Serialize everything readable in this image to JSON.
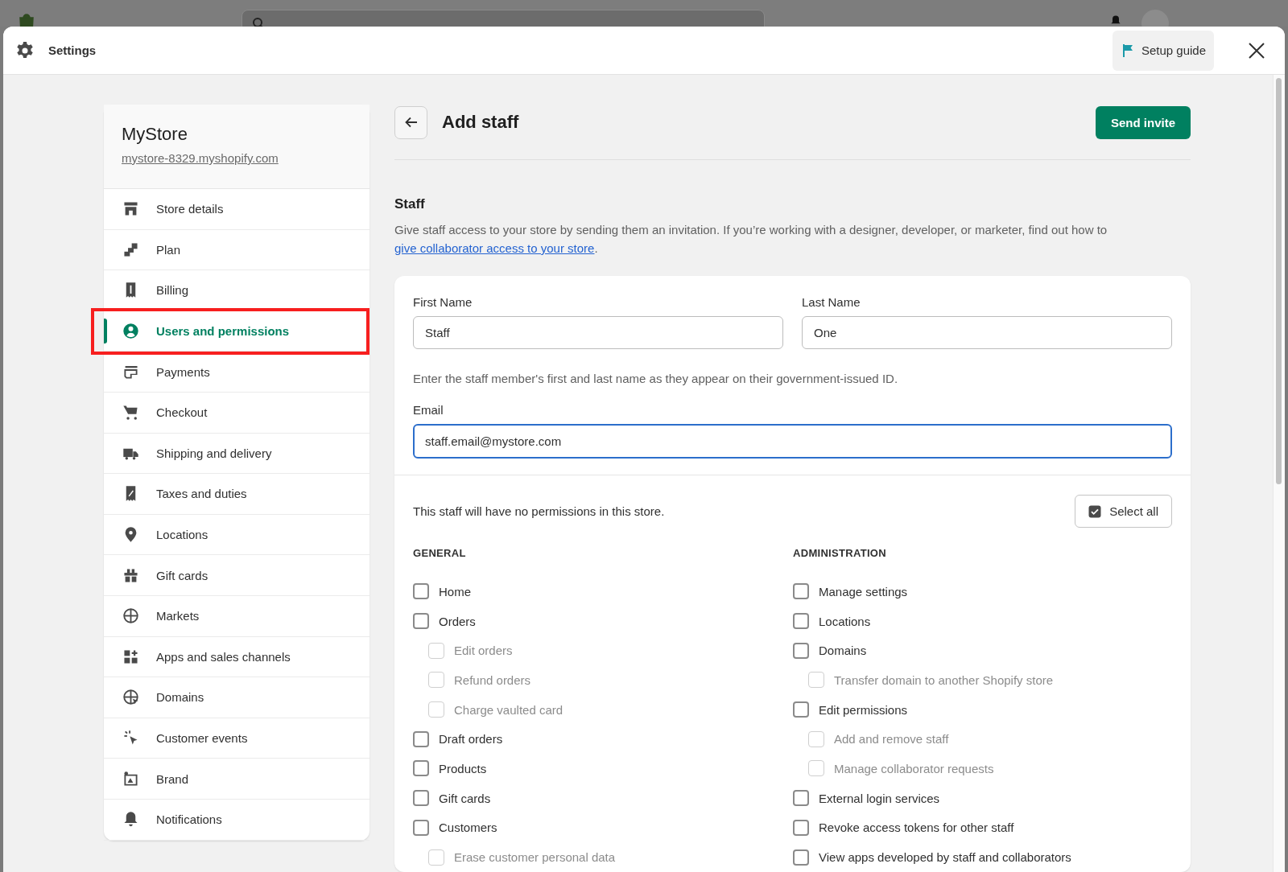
{
  "modal": {
    "title": "Settings",
    "setup_guide": "Setup guide"
  },
  "sidebar": {
    "store_name": "MyStore",
    "store_url": "mystore-8329.myshopify.com",
    "items": [
      {
        "label": "Store details",
        "selected": false,
        "outlined": false
      },
      {
        "label": "Plan",
        "selected": false,
        "outlined": false
      },
      {
        "label": "Billing",
        "selected": false,
        "outlined": false
      },
      {
        "label": "Users and permissions",
        "selected": true,
        "outlined": true
      },
      {
        "label": "Payments",
        "selected": false,
        "outlined": false
      },
      {
        "label": "Checkout",
        "selected": false,
        "outlined": false
      },
      {
        "label": "Shipping and delivery",
        "selected": false,
        "outlined": false
      },
      {
        "label": "Taxes and duties",
        "selected": false,
        "outlined": false
      },
      {
        "label": "Locations",
        "selected": false,
        "outlined": false
      },
      {
        "label": "Gift cards",
        "selected": false,
        "outlined": false
      },
      {
        "label": "Markets",
        "selected": false,
        "outlined": false
      },
      {
        "label": "Apps and sales channels",
        "selected": false,
        "outlined": false
      },
      {
        "label": "Domains",
        "selected": false,
        "outlined": false
      },
      {
        "label": "Customer events",
        "selected": false,
        "outlined": false
      },
      {
        "label": "Brand",
        "selected": false,
        "outlined": false
      },
      {
        "label": "Notifications",
        "selected": false,
        "outlined": false
      }
    ]
  },
  "page": {
    "title": "Add staff",
    "send_button": "Send invite",
    "section_title": "Staff",
    "description_before": "Give staff access to your store by sending them an invitation. If you’re working with a designer, developer, or marketer, find out how to ",
    "description_link": "give collaborator access to your store",
    "description_after": ".",
    "first_name": {
      "label": "First Name",
      "value": "Staff",
      "focused": false
    },
    "last_name": {
      "label": "Last Name",
      "value": "One",
      "focused": false
    },
    "name_help": "Enter the staff member's first and last name as they appear on their government-issued ID.",
    "email": {
      "label": "Email",
      "value": "staff.email@mystore.com",
      "focused": true
    },
    "permissions_note": "This staff will have no permissions in this store.",
    "select_all": "Select all",
    "groups": [
      {
        "title": "GENERAL",
        "items": [
          {
            "label": "Home",
            "checked": false,
            "disabled": false
          },
          {
            "label": "Orders",
            "checked": false,
            "disabled": false,
            "children": [
              {
                "label": "Edit orders",
                "checked": false,
                "disabled": true
              },
              {
                "label": "Refund orders",
                "checked": false,
                "disabled": true
              },
              {
                "label": "Charge vaulted card",
                "checked": false,
                "disabled": true
              }
            ]
          },
          {
            "label": "Draft orders",
            "checked": false,
            "disabled": false
          },
          {
            "label": "Products",
            "checked": false,
            "disabled": false
          },
          {
            "label": "Gift cards",
            "checked": false,
            "disabled": false
          },
          {
            "label": "Customers",
            "checked": false,
            "disabled": false,
            "children": [
              {
                "label": "Erase customer personal data",
                "checked": false,
                "disabled": true
              }
            ]
          }
        ]
      },
      {
        "title": "ADMINISTRATION",
        "items": [
          {
            "label": "Manage settings",
            "checked": false,
            "disabled": false
          },
          {
            "label": "Locations",
            "checked": false,
            "disabled": false
          },
          {
            "label": "Domains",
            "checked": false,
            "disabled": false,
            "children": [
              {
                "label": "Transfer domain to another Shopify store",
                "checked": false,
                "disabled": true
              }
            ]
          },
          {
            "label": "Edit permissions",
            "checked": false,
            "disabled": false,
            "children": [
              {
                "label": "Add and remove staff",
                "checked": false,
                "disabled": true
              },
              {
                "label": "Manage collaborator requests",
                "checked": false,
                "disabled": true
              }
            ]
          },
          {
            "label": "External login services",
            "checked": false,
            "disabled": false
          },
          {
            "label": "Revoke access tokens for other staff",
            "checked": false,
            "disabled": false
          },
          {
            "label": "View apps developed by staff and collaborators",
            "checked": false,
            "disabled": false
          }
        ]
      }
    ]
  }
}
